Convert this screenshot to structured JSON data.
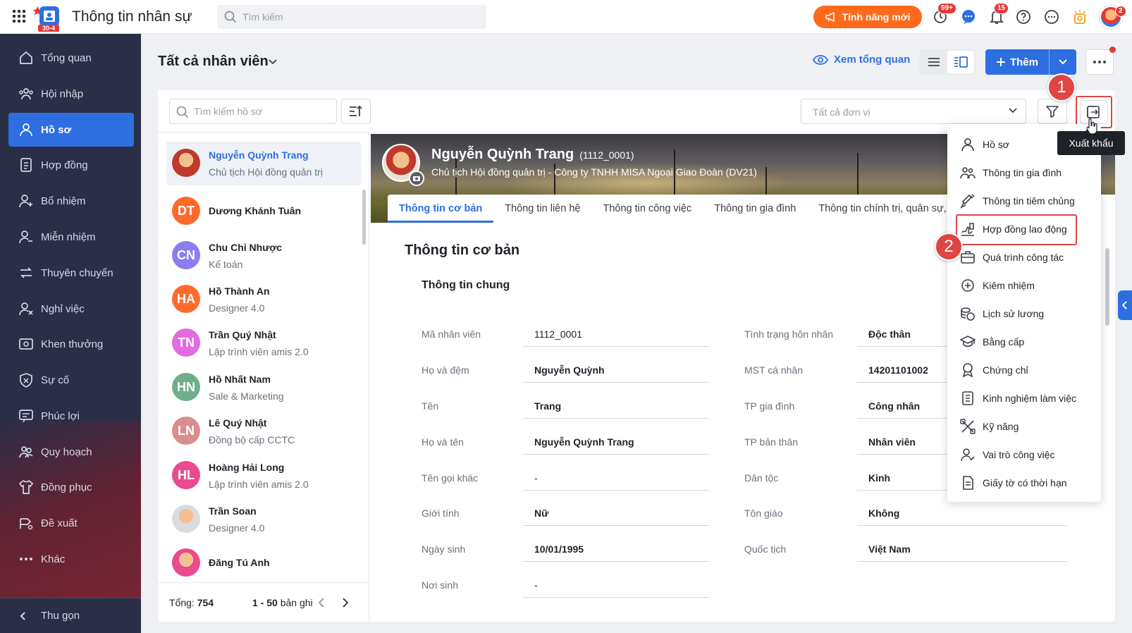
{
  "app": {
    "title": "Thông tin nhân sự",
    "logo_badge": "30-4"
  },
  "top_search": {
    "placeholder": "Tìm kiếm"
  },
  "topbar": {
    "new_features_label": "Tính năng mới",
    "badges": {
      "clock": "99+",
      "bell": "15",
      "avatar": "2"
    }
  },
  "sidebar": {
    "items": [
      {
        "label": "Tổng quan",
        "icon": "home-icon"
      },
      {
        "label": "Hội nhập",
        "icon": "team-icon"
      },
      {
        "label": "Hồ sơ",
        "icon": "person-icon",
        "active": true
      },
      {
        "label": "Hợp đồng",
        "icon": "contract-icon"
      },
      {
        "label": "Bổ nhiệm",
        "icon": "person-add-icon"
      },
      {
        "label": "Miễn nhiệm",
        "icon": "person-remove-icon"
      },
      {
        "label": "Thuyên chuyển",
        "icon": "transfer-icon"
      },
      {
        "label": "Nghỉ việc",
        "icon": "person-leave-icon"
      },
      {
        "label": "Khen thưởng",
        "icon": "award-icon"
      },
      {
        "label": "Sự cố",
        "icon": "shield-x-icon"
      },
      {
        "label": "Phúc lợi",
        "icon": "benefit-icon"
      },
      {
        "label": "Quy hoạch",
        "icon": "planning-icon"
      },
      {
        "label": "Đồng phục",
        "icon": "shirt-icon"
      },
      {
        "label": "Đề xuất",
        "icon": "proposal-icon"
      },
      {
        "label": "Khác",
        "icon": "more-icon"
      }
    ],
    "collapse_label": "Thu gọn"
  },
  "header": {
    "title": "Tất cả nhân viên",
    "overview_label": "Xem tổng quan",
    "add_label": "Thêm"
  },
  "toolbar": {
    "profile_search_placeholder": "Tìm kiếm hồ sơ",
    "unit_placeholder": "Tất cả đơn vị",
    "export_tooltip": "Xuất khẩu"
  },
  "employees": [
    {
      "initials": "",
      "name": "Nguyễn Quỳnh Trang",
      "title": "Chủ tịch Hội đồng quản trị",
      "color": "#c0392b",
      "selected": true
    },
    {
      "initials": "DT",
      "name": "Dương Khánh Tuân",
      "title": "",
      "color": "#ff6a2c"
    },
    {
      "initials": "CN",
      "name": "Chu Chỉ Nhược",
      "title": "Kế toán",
      "color": "#8a7df0"
    },
    {
      "initials": "HA",
      "name": "Hồ Thành An",
      "title": "Designer 4.0",
      "color": "#ff6a2c"
    },
    {
      "initials": "TN",
      "name": "Trần Quý Nhật",
      "title": "Lập trình viên amis 2.0",
      "color": "#e36be0"
    },
    {
      "initials": "HN",
      "name": "Hồ Nhất Nam",
      "title": "Sale & Marketing",
      "color": "#6fae8a"
    },
    {
      "initials": "LN",
      "name": "Lê Quý Nhật",
      "title": "Đồng bộ cấp CCTC",
      "color": "#d98d8d"
    },
    {
      "initials": "HL",
      "name": "Hoàng Hải Long",
      "title": "Lập trình viên amis 2.0",
      "color": "#ea4a8e"
    },
    {
      "initials": "",
      "name": "Trần Soan",
      "title": "Designer 4.0",
      "color": "#d9dbe0"
    },
    {
      "initials": "",
      "name": "Đăng Tú Anh",
      "title": "",
      "color": "#ea4a8e"
    }
  ],
  "list_footer": {
    "total_label": "Tổng:",
    "total_value": "754",
    "range_label": "1 - 50",
    "range_suffix": "bản ghi"
  },
  "profile": {
    "name": "Nguyễn Quỳnh Trang",
    "code": "(1112_0001)",
    "subtitle": "Chủ tịch Hội đồng quản trị - Công ty TNHH MISA Ngoại Giao Đoàn (DV21)",
    "tabs": [
      "Thông tin cơ bản",
      "Thông tin liên hệ",
      "Thông tin công việc",
      "Thông tin gia đình",
      "Thông tin chính trị, quân sự, y tế"
    ],
    "section_title": "Thông tin cơ bản",
    "group_title": "Thông tin chung",
    "left_fields": [
      {
        "label": "Mã nhân viên",
        "value": "1112_0001",
        "plain": true
      },
      {
        "label": "Họ và đệm",
        "value": "Nguyễn Quỳnh"
      },
      {
        "label": "Tên",
        "value": "Trang"
      },
      {
        "label": "Họ và tên",
        "value": "Nguyễn Quỳnh Trang"
      },
      {
        "label": "Tên gọi khác",
        "value": "-",
        "plain": true
      },
      {
        "label": "Giới tính",
        "value": "Nữ"
      },
      {
        "label": "Ngày sinh",
        "value": "10/01/1995"
      },
      {
        "label": "Nơi sinh",
        "value": "-",
        "plain": true
      }
    ],
    "right_fields": [
      {
        "label": "Tình trạng hôn nhân",
        "value": "Độc thân"
      },
      {
        "label": "MST cá nhân",
        "value": "14201101002"
      },
      {
        "label": "TP gia đình",
        "value": "Công nhân"
      },
      {
        "label": "TP bản thân",
        "value": "Nhân viên"
      },
      {
        "label": "Dân tộc",
        "value": "Kinh"
      },
      {
        "label": "Tôn giáo",
        "value": "Không"
      },
      {
        "label": "Quốc tịch",
        "value": "Việt Nam"
      }
    ]
  },
  "export_menu": {
    "items": [
      {
        "label": "Hồ sơ",
        "icon": "person-icon"
      },
      {
        "label": "Thông tin gia đình",
        "icon": "family-icon"
      },
      {
        "label": "Thông tin tiêm chủng",
        "icon": "syringe-icon"
      },
      {
        "label": "Hợp đồng lao động",
        "icon": "sign-contract-icon",
        "highlighted": true
      },
      {
        "label": "Quá trình công tác",
        "icon": "briefcase-icon"
      },
      {
        "label": "Kiêm nhiệm",
        "icon": "plus-circle-icon"
      },
      {
        "label": "Lịch sử lương",
        "icon": "coins-icon"
      },
      {
        "label": "Bằng cấp",
        "icon": "graduation-cap-icon"
      },
      {
        "label": "Chứng chỉ",
        "icon": "certificate-icon"
      },
      {
        "label": "Kinh nghiệm làm việc",
        "icon": "document-icon"
      },
      {
        "label": "Kỹ năng",
        "icon": "tools-icon"
      },
      {
        "label": "Vai trò công việc",
        "icon": "person-check-icon"
      },
      {
        "label": "Giấy tờ có thời hạn",
        "icon": "file-icon"
      }
    ]
  },
  "steps": [
    "1",
    "2"
  ],
  "colors": {
    "primary": "#2d6fe0",
    "sidebar": "#2b2e47",
    "orange": "#ff6a1a",
    "highlight": "#e04545"
  }
}
